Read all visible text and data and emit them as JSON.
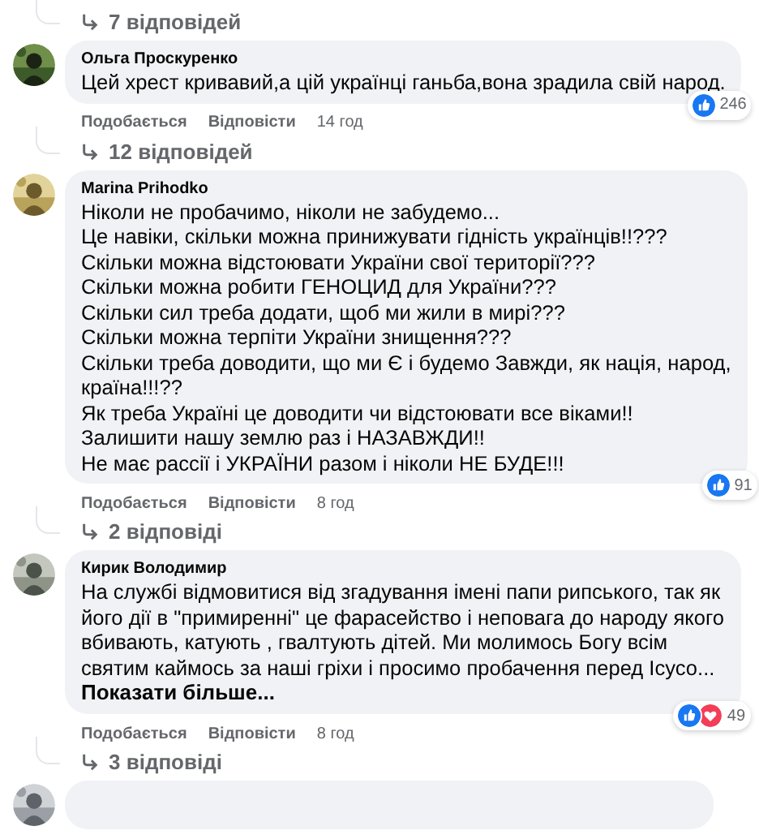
{
  "top_replies": {
    "label": "7 відповідей"
  },
  "comments": [
    {
      "author": "Ольга Проскуренко",
      "lines": [
        "Цей хрест кривавий,а цій українці ганьба,вона зрадила свій народ."
      ],
      "reactions": [
        {
          "kind": "like"
        }
      ],
      "reaction_count": "246",
      "actions": [
        "Подобається",
        "Відповісти"
      ],
      "time": "14 год",
      "replies": "12 відповідей"
    },
    {
      "author": "Marina Prihodko",
      "lines": [
        "Ніколи не пробачимо, ніколи не забудемо...",
        "Це навіки, скільки можна принижувати гідність українців!!???",
        "Скільки можна відстоювати України свої території???",
        "Скільки можна робити ГЕНОЦИД для України???",
        "Скільки сил треба додати, щоб ми жили в мирі???",
        "Скільки можна терпіти України знищення???",
        "Скільки треба доводити, що ми Є і будемо Завжди, як нація, народ,",
        "країна!!!??",
        "Як треба Україні це доводити чи відстоювати все віками!!",
        "Залишити нашу землю раз і НАЗАВЖДИ!!",
        "Не має рассії і УКРАЇНИ разом і ніколи НЕ БУДЕ!!!"
      ],
      "reactions": [
        {
          "kind": "like"
        }
      ],
      "reaction_count": "91",
      "actions": [
        "Подобається",
        "Відповісти"
      ],
      "time": "8 год",
      "replies": "2 відповіді"
    },
    {
      "author": "Кирик Володимир",
      "lines": [
        "На службі відмовитися від згадування імені папи рипського, так як",
        "його дії в \"примиренні\" це фарасейство і неповага до народу якого",
        "вбивають, катують , гвалтують дітей. Ми молимось Богу всім",
        "святим каймось за наші гріхи і просимо пробачення перед Ісусо..."
      ],
      "see_more": "Показати більше...",
      "reactions": [
        {
          "kind": "like"
        },
        {
          "kind": "love"
        }
      ],
      "reaction_count": "49",
      "actions": [
        "Подобається",
        "Відповісти"
      ],
      "time": "8 год",
      "replies": "3 відповіді"
    }
  ]
}
